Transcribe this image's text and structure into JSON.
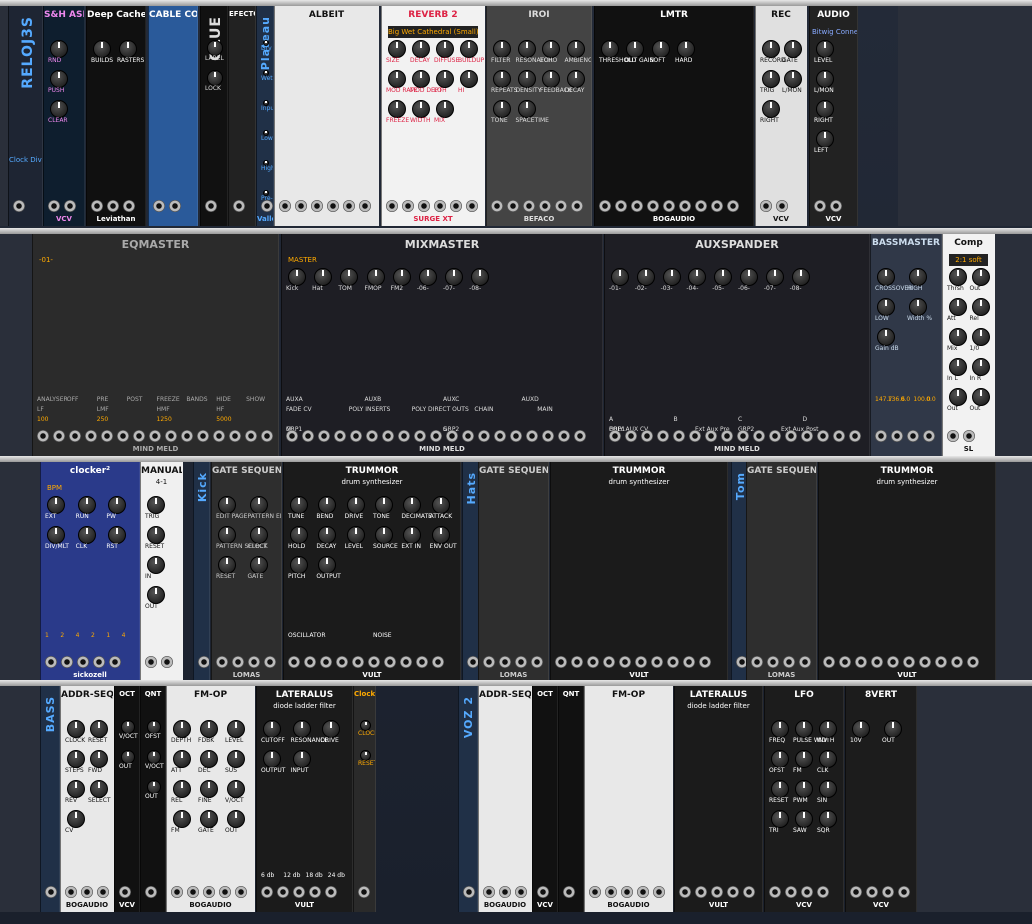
{
  "rows": [
    {
      "modules": [
        {
          "id": "reloj3s",
          "label": "RELOJ3S",
          "sub": "Clock Divider"
        },
        {
          "id": "sh-asr",
          "label": "S&H ASR",
          "brand": "VCV",
          "controls": [
            "RND",
            "PUSH",
            "CLEAR"
          ]
        },
        {
          "id": "deep-cache",
          "label": "Deep Cache",
          "items": [
            "BUILDS",
            "RASTERS"
          ],
          "brand": "Leviathan"
        },
        {
          "id": "cable-colour-key",
          "label": "CABLE COLOUR KEY"
        },
        {
          "id": "glue",
          "label": "GLUE",
          "items": [
            "LABEL",
            "LOCK"
          ]
        },
        {
          "id": "efectos",
          "label": "EFECTOS"
        },
        {
          "id": "plateau",
          "label": "Plateau",
          "brand": "Valley",
          "controls": [
            "Dry",
            "Wet",
            "Input Filter",
            "Low",
            "High",
            "Pre-D",
            "Tuned Mode",
            "Size",
            "Diffuse",
            "Decay",
            "Diffusion",
            "Reverb Filter",
            "Hold",
            "Mod Rate",
            "Mod Shape",
            "Mod Depth"
          ]
        },
        {
          "id": "albeit",
          "label": "ALBEIT"
        },
        {
          "id": "reverb2",
          "label": "REVERB 2",
          "preset": "Big Wet Cathedral (Small)",
          "controls": [
            "SIZE",
            "DECAY",
            "DIFFUSE",
            "BUILDUP",
            "MOD RATE",
            "MOD DEPTH",
            "LO",
            "HI",
            "FREEZE",
            "WIDTH",
            "MIX"
          ],
          "brand": "SURGE XT"
        },
        {
          "id": "iroi",
          "label": "IROI",
          "controls": [
            "FILTER",
            "RESONATOR",
            "ECHO",
            "AMBIENCE",
            "REPEATS",
            "DENSITY",
            "FEEDBACK",
            "DECAY",
            "TONE",
            "SPACETIME"
          ],
          "brand": "BEFACO"
        },
        {
          "id": "lmtr",
          "label": "LMTR",
          "controls": [
            "THRESHOLD",
            "OUT GAIN",
            "SOFT",
            "HARD"
          ],
          "brand": "BOGAUDIO"
        },
        {
          "id": "rec",
          "label": "REC",
          "controls": [
            "RECORD",
            "GATE",
            "TRIG",
            "L/MON",
            "RIGHT"
          ],
          "brand": "VCV"
        },
        {
          "id": "audio",
          "label": "AUDIO",
          "device": "Bitwig Connec",
          "controls": [
            "LEVEL",
            "L/MON",
            "RIGHT",
            "LEFT"
          ],
          "brand": "VCV"
        }
      ]
    },
    {
      "modules": [
        {
          "id": "eqmaster",
          "label": "EQMASTER",
          "tabs": [
            "ANALYSER",
            "OFF",
            "PRE",
            "POST",
            "FREEZE",
            "BANDS",
            "HIDE",
            "SHOW"
          ],
          "bands": [
            "LF",
            "LMF",
            "HMF",
            "HF"
          ],
          "freqs": [
            "100",
            "250",
            "1250",
            "5000"
          ],
          "track": "-01-",
          "brand": "MIND MELD"
        },
        {
          "id": "mixmaster",
          "label": "MIXMASTER",
          "tracks": [
            "Kick",
            "Hat",
            "TOM",
            "FMOP",
            "FM2",
            "-06-",
            "-07-",
            "-08-"
          ],
          "groups": [
            "GRP1",
            "GRP2"
          ],
          "master": "MASTER",
          "aux": [
            "AUXA",
            "AUXB",
            "AUXC",
            "AUXD"
          ],
          "sections": [
            "FADE CV",
            "POLY INSERTS",
            "POLY DIRECT OUTS",
            "CHAIN",
            "MAIN"
          ],
          "buttons": [
            "M",
            "S"
          ],
          "brand": "MIND MELD"
        },
        {
          "id": "auxspander",
          "label": "AUXSPANDER",
          "tracks": [
            "-01-",
            "-02-",
            "-03-",
            "-04-",
            "-05-",
            "-06-",
            "-07-",
            "-08-"
          ],
          "groups": [
            "GRP1",
            "GRP2"
          ],
          "aux_sends": [
            "A",
            "B",
            "C",
            "D"
          ],
          "side": [
            "POLY AUX CV",
            "Ext Aux Pre",
            "Ext Aux Post"
          ],
          "brand": "MIND MELD"
        },
        {
          "id": "bassmaster",
          "label": "BASSMASTER",
          "controls": [
            "CROSSOVER",
            "HIGH",
            "LOW",
            "Width %",
            "Gain dB"
          ],
          "values": [
            "147.7",
            "136.6",
            "0.0",
            "100.0",
            "0.0"
          ]
        },
        {
          "id": "comp",
          "label": "Comp",
          "preset": "2:1 soft",
          "controls": [
            "Thrsh",
            "Out",
            "Att",
            "Rel",
            "Mix",
            "1/0",
            "In L",
            "In R",
            "Out",
            "Out"
          ],
          "brand": "SL"
        }
      ]
    },
    {
      "modules": [
        {
          "id": "clocker2",
          "label": "clocker²",
          "bpm": "BPM",
          "controls": [
            "EXT",
            "RUN",
            "PW",
            "DIV/MLT",
            "CLK",
            "RST"
          ],
          "div_values": [
            "1",
            "2",
            "4",
            "2",
            "1",
            "4"
          ],
          "brand": "sickozell"
        },
        {
          "id": "manual",
          "label": "MANUAL",
          "sub": "4-1",
          "controls": [
            "TRIG",
            "RESET",
            "IN",
            "OUT"
          ]
        },
        {
          "id": "kick-label",
          "label": "Kick"
        },
        {
          "id": "gate-seq-1",
          "label": "GATE SEQUENCER",
          "controls": [
            "EDIT PAGE",
            "PATTERN EDITOR",
            "PATTERN SELECT",
            "CLOCK",
            "RESET",
            "GATE"
          ],
          "brand": "LOMAS"
        },
        {
          "id": "trummor-1",
          "label": "TRUMMOR",
          "sub": "drum synthesizer",
          "sections": [
            "OSCILLATOR",
            "NOISE"
          ],
          "controls": [
            "TUNE",
            "BEND",
            "DRIVE",
            "TONE",
            "DECIMATE",
            "ATTACK",
            "HOLD",
            "DECAY",
            "LEVEL",
            "SOURCE",
            "EXT IN",
            "ENV OUT",
            "PITCH",
            "OUTPUT"
          ],
          "brand": "VULT"
        },
        {
          "id": "hats-label",
          "label": "Hats"
        },
        {
          "id": "gate-seq-2",
          "label": "GATE SEQUENCER",
          "brand": "LOMAS"
        },
        {
          "id": "trummor-2",
          "label": "TRUMMOR",
          "sub": "drum synthesizer",
          "brand": "VULT"
        },
        {
          "id": "tom-label",
          "label": "Tom"
        },
        {
          "id": "gate-seq-3",
          "label": "GATE SEQUENCER",
          "brand": "LOMAS"
        },
        {
          "id": "trummor-3",
          "label": "TRUMMOR",
          "sub": "drum synthesizer",
          "brand": "VULT"
        }
      ]
    },
    {
      "modules": [
        {
          "id": "bass-label",
          "label": "BASS"
        },
        {
          "id": "addr-seq-1",
          "label": "ADDR-SEQ",
          "controls": [
            "CLOCK",
            "RESET",
            "STEPS",
            "FWD",
            "REV",
            "SELECT",
            "CV"
          ],
          "brand": "BOGAUDIO"
        },
        {
          "id": "oct-1",
          "label": "OCT",
          "controls": [
            "V/OCT",
            "OUT"
          ],
          "brand": "VCV"
        },
        {
          "id": "qnt-1",
          "label": "QNT",
          "controls": [
            "OFST",
            "V/OCT",
            "OUT"
          ]
        },
        {
          "id": "fm-op-1",
          "label": "FM-OP",
          "controls": [
            "DEPTH",
            "FDBK",
            "LEVEL",
            "ATT",
            "DEC",
            "SUS",
            "REL",
            "FINE",
            "V/OCT",
            "FM",
            "GATE",
            "OUT"
          ],
          "brand": "BOGAUDIO"
        },
        {
          "id": "lateralus-1",
          "label": "LATERALUS",
          "sub": "diode ladder filter",
          "controls": [
            "CUTOFF",
            "RESONANCE",
            "DRIVE",
            "OUTPUT",
            "INPUT"
          ],
          "slopes": [
            "6 db",
            "12 db",
            "18 db",
            "24 db"
          ],
          "brand": "VULT"
        },
        {
          "id": "clock-div",
          "label": "Clock Divider",
          "controls": [
            "CLOCK",
            "RESET"
          ]
        },
        {
          "id": "voz2-label",
          "label": "VOZ 2"
        },
        {
          "id": "addr-seq-2",
          "label": "ADDR-SEQ",
          "brand": "BOGAUDIO"
        },
        {
          "id": "oct-2",
          "label": "OCT",
          "brand": "VCV"
        },
        {
          "id": "qnt-2",
          "label": "QNT"
        },
        {
          "id": "fm-op-2",
          "label": "FM-OP",
          "brand": "BOGAUDIO"
        },
        {
          "id": "lateralus-2",
          "label": "LATERALUS",
          "sub": "diode ladder filter",
          "brand": "VULT"
        },
        {
          "id": "lfo",
          "label": "LFO",
          "controls": [
            "FREQ",
            "PULSE WIDTH",
            "INV",
            "OFST",
            "FM",
            "CLK",
            "RESET",
            "PWM",
            "SIN",
            "TRI",
            "SAW",
            "SQR"
          ],
          "brand": "VCV"
        },
        {
          "id": "8vert",
          "label": "8VERT",
          "controls": [
            "10V",
            "OUT"
          ],
          "brand": "VCV"
        }
      ]
    }
  ]
}
